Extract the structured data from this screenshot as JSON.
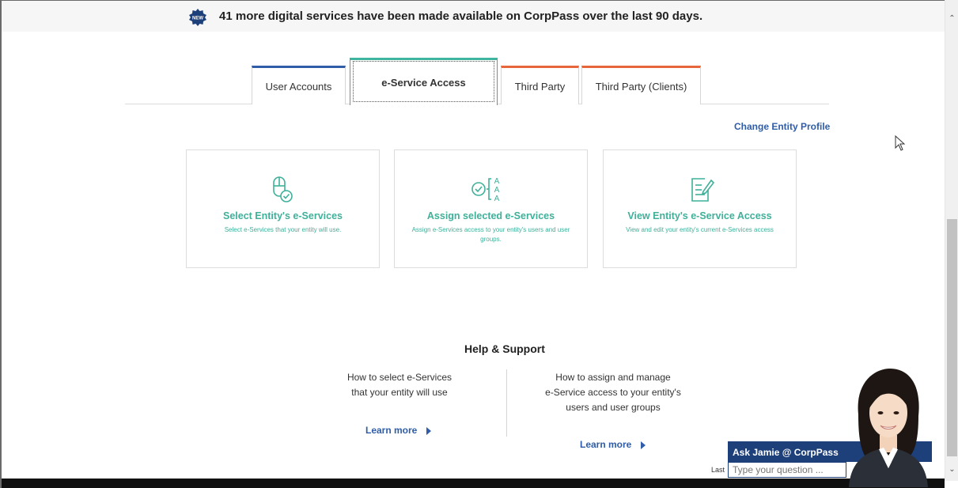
{
  "banner": {
    "badge": "NEW",
    "text": "41 more digital services have been made available on CorpPass over the last 90 days."
  },
  "tabs": [
    {
      "label": "User Accounts",
      "accent": "#2f5da8"
    },
    {
      "label": "e-Service Access",
      "accent": "#3fb5a0",
      "active": true
    },
    {
      "label": "Third Party",
      "accent": "#e8663c"
    },
    {
      "label": "Third Party (Clients)",
      "accent": "#e8663c"
    }
  ],
  "change_profile": "Change Entity Profile",
  "cards": [
    {
      "icon": "mouse-check-icon",
      "title": "Select Entity's e-Services",
      "desc": "Select e-Services that your entity will use."
    },
    {
      "icon": "assign-users-icon",
      "title": "Assign selected e-Services",
      "desc": "Assign e-Services access to your entity's users and user groups."
    },
    {
      "icon": "edit-document-icon",
      "title": "View Entity's e-Service Access",
      "desc": "View and edit your entity's current e-Services access"
    }
  ],
  "help": {
    "title": "Help & Support",
    "left": {
      "line1": "How to select e-Services",
      "line2": "that your entity will use",
      "link": "Learn more"
    },
    "right": {
      "line1": "How to assign and manage",
      "line2": "e-Service access to your entity's",
      "line3": "users and user groups",
      "link": "Learn more"
    }
  },
  "footer": {
    "last": "Last"
  },
  "chat": {
    "header": "Ask Jamie @ CorpPass",
    "placeholder": "Type your question ..."
  },
  "colors": {
    "brand_blue": "#2f5da8",
    "teal": "#3fb09a",
    "orange": "#e8663c",
    "chat_blue": "#1d3f7a"
  }
}
